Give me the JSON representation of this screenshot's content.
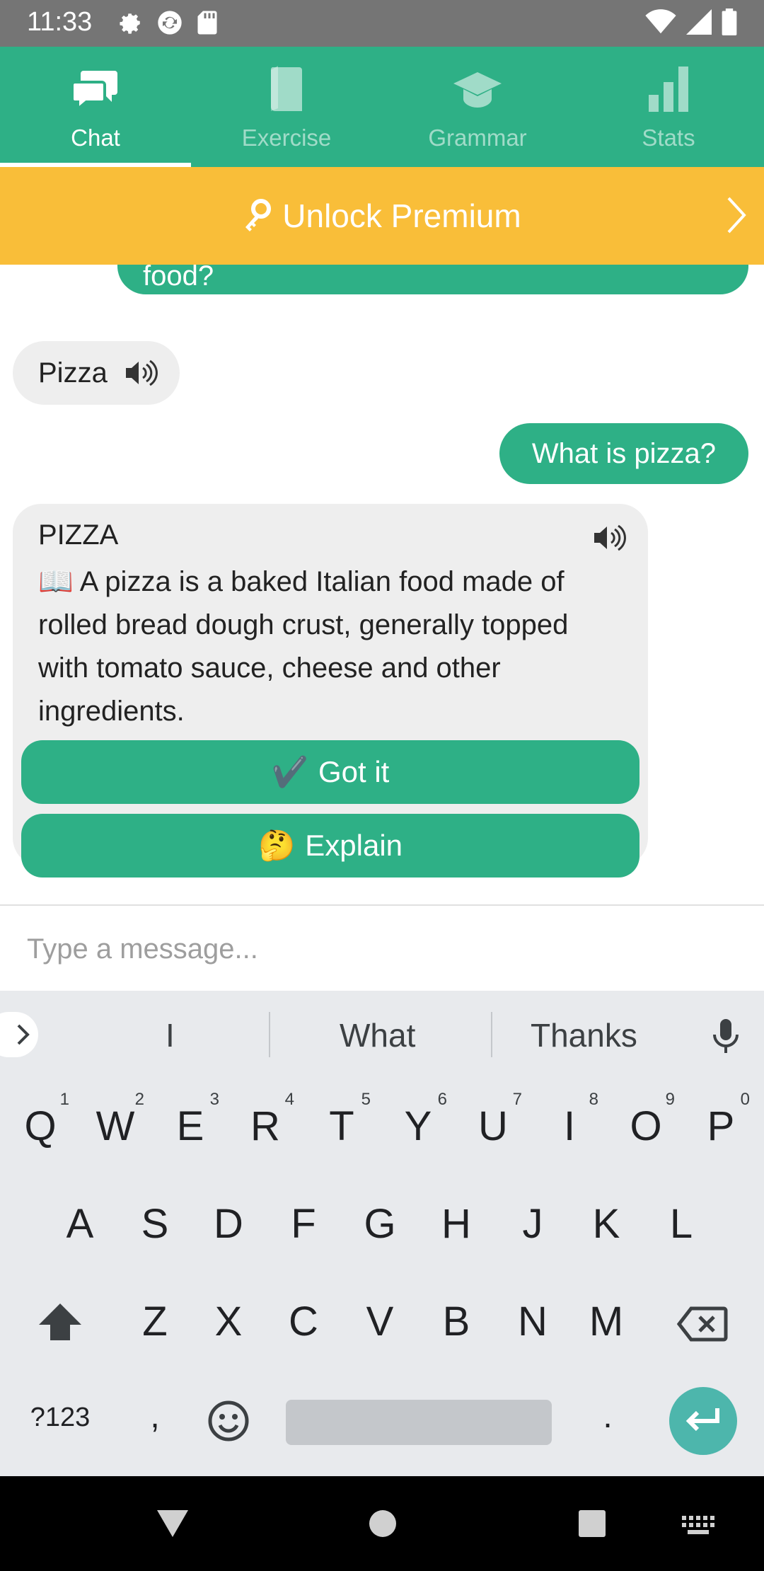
{
  "status_bar": {
    "time": "11:33"
  },
  "tabs": [
    {
      "label": "Chat",
      "active": true
    },
    {
      "label": "Exercise",
      "active": false
    },
    {
      "label": "Grammar",
      "active": false
    },
    {
      "label": "Stats",
      "active": false
    }
  ],
  "premium": {
    "label": "Unlock Premium"
  },
  "chat": {
    "partial_message": "food?",
    "word_bubble": "Pizza",
    "user_message": "What is pizza?",
    "definition": {
      "title": "PIZZA",
      "icon": "📖",
      "text": "A pizza is a baked Italian food made of rolled bread dough crust, generally topped with tomato sauce, cheese and other ingredients.",
      "got_it": {
        "emoji": "✔️",
        "label": "Got it"
      },
      "explain": {
        "emoji": "🤔",
        "label": "Explain"
      }
    }
  },
  "input": {
    "placeholder": "Type a message..."
  },
  "keyboard": {
    "suggestions": [
      "I",
      "What",
      "Thanks"
    ],
    "row1": [
      "Q",
      "W",
      "E",
      "R",
      "T",
      "Y",
      "U",
      "I",
      "O",
      "P"
    ],
    "row1_nums": [
      "1",
      "2",
      "3",
      "4",
      "5",
      "6",
      "7",
      "8",
      "9",
      "0"
    ],
    "row2": [
      "A",
      "S",
      "D",
      "F",
      "G",
      "H",
      "J",
      "K",
      "L"
    ],
    "row3": [
      "Z",
      "X",
      "C",
      "V",
      "B",
      "N",
      "M"
    ],
    "symbols_key": "?123",
    "comma": ",",
    "period": "."
  },
  "colors": {
    "accent": "#2eb086",
    "premium": "#f9be39",
    "status_bar": "#757575"
  }
}
